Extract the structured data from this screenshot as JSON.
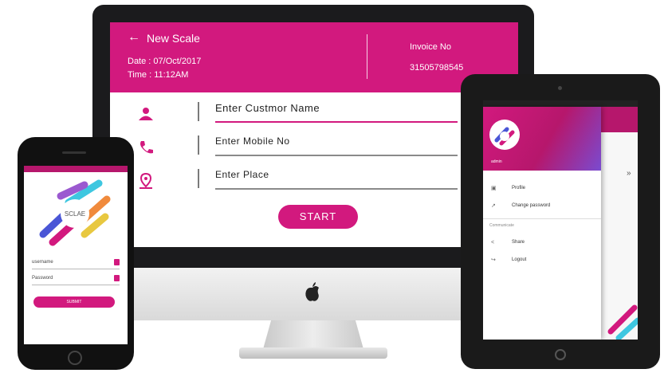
{
  "desktop": {
    "back_icon": "arrow-left-icon",
    "title": "New Scale",
    "date": "Date :  07/Oct/2017",
    "time": "Time : 11:12AM",
    "invoice_label": "Invoice No",
    "invoice_value": "31505798545",
    "fields": [
      {
        "icon": "user-icon",
        "placeholder": "Enter Custmor Name"
      },
      {
        "icon": "phone-icon",
        "placeholder": "Enter Mobile No"
      },
      {
        "icon": "location-pin-icon",
        "placeholder": "Enter Place"
      }
    ],
    "start_label": "START",
    "accent_color": "#d2197e"
  },
  "phone": {
    "logo_text": "SCLAE",
    "username_label": "username",
    "password_label": "Password",
    "submit_label": "SUBMIT"
  },
  "tablet": {
    "drawer_user": "admin",
    "menu_items": [
      {
        "icon": "profile-icon",
        "label": "Profile"
      },
      {
        "icon": "key-icon",
        "label": "Change password"
      }
    ],
    "section_label": "Communicate",
    "section_items": [
      {
        "icon": "share-icon",
        "label": "Share"
      },
      {
        "icon": "logout-icon",
        "label": "Logout"
      }
    ]
  }
}
